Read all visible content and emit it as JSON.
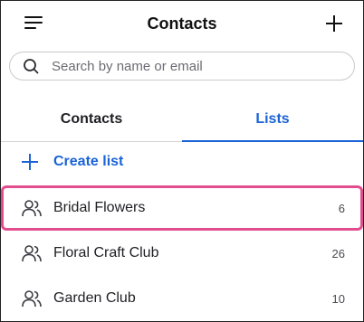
{
  "header": {
    "title": "Contacts"
  },
  "search": {
    "placeholder": "Search by name or email",
    "value": ""
  },
  "tabs": [
    {
      "label": "Contacts",
      "active": false
    },
    {
      "label": "Lists",
      "active": true
    }
  ],
  "create_list": {
    "label": "Create list"
  },
  "lists": [
    {
      "name": "Bridal Flowers",
      "count": "6",
      "selected": true
    },
    {
      "name": "Floral Craft Club",
      "count": "26",
      "selected": false
    },
    {
      "name": "Garden Club",
      "count": "10",
      "selected": false
    }
  ],
  "colors": {
    "accent": "#1b63d6",
    "highlight": "#e24d8e"
  }
}
